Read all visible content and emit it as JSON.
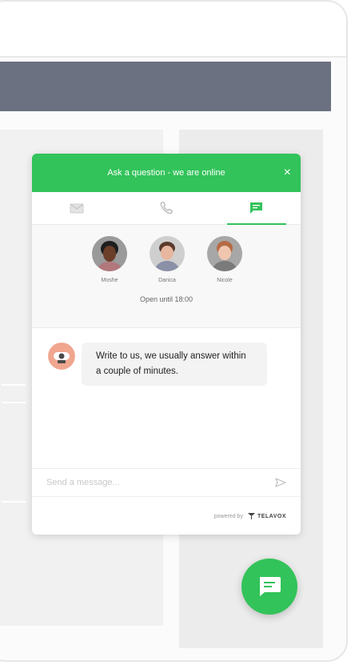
{
  "widget": {
    "header_title": "Ask a question - we are online",
    "close_icon": "×",
    "tabs": [
      {
        "name": "email",
        "icon": "envelope-icon"
      },
      {
        "name": "phone",
        "icon": "phone-icon"
      },
      {
        "name": "chat",
        "icon": "chat-icon",
        "active": true
      }
    ],
    "agents": [
      {
        "name": "Moshe"
      },
      {
        "name": "Danica"
      },
      {
        "name": "Nicole"
      }
    ],
    "open_until": "Open until 18:00",
    "message": "Write to us, we usually answer within a couple of minutes.",
    "composer_placeholder": "Send a message...",
    "powered_by": "powered by",
    "brand_name": "TELAVOX"
  },
  "colors": {
    "accent": "#32c35a",
    "header_band": "#6b7180"
  }
}
